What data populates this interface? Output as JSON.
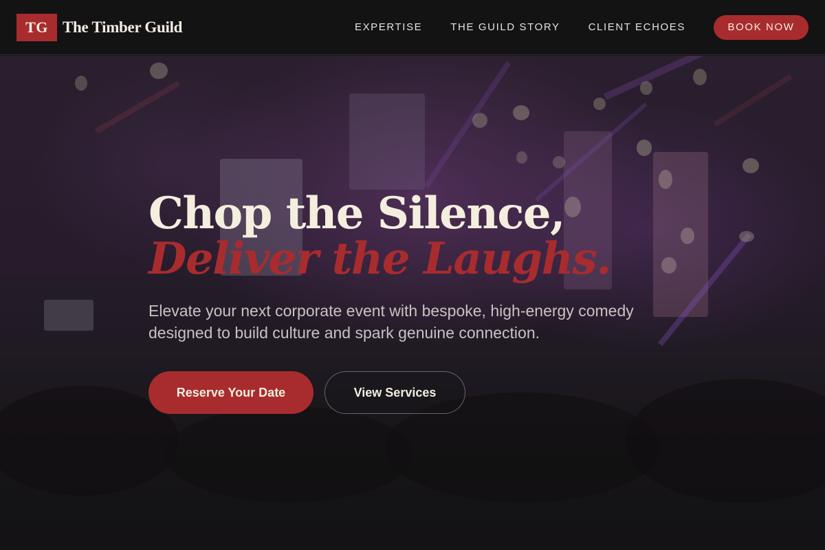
{
  "brand": {
    "mark": "TG",
    "name": "The Timber Guild",
    "accent_color": "#a82c2e"
  },
  "nav": {
    "links": [
      {
        "label": "EXPERTISE"
      },
      {
        "label": "THE GUILD STORY"
      },
      {
        "label": "CLIENT ECHOES"
      }
    ],
    "book_label": "BOOK NOW"
  },
  "hero": {
    "headline_line1": "Chop the Silence,",
    "headline_line2": "Deliver the Laughs.",
    "subtext": "Elevate your next corporate event with bespoke, high-energy comedy designed to build culture and spark genuine connection.",
    "primary_cta": "Reserve Your Date",
    "secondary_cta": "View Services",
    "background_image": "blurred-event-stage-photo"
  }
}
